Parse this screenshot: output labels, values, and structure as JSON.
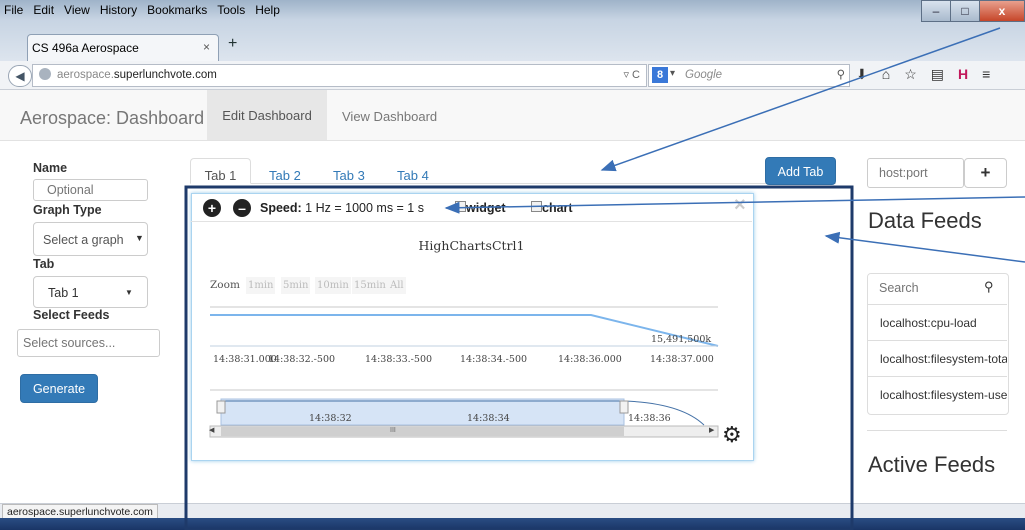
{
  "browser": {
    "menu": [
      "File",
      "Edit",
      "View",
      "History",
      "Bookmarks",
      "Tools",
      "Help"
    ],
    "tab_title": "CS 496a Aerospace",
    "tab_close": "×",
    "new_tab": "+",
    "url_prefix": "aerospace.",
    "url_domain": "superlunchvote.com",
    "search_engine_glyph": "8",
    "search_placeholder": "Google",
    "window_buttons": [
      "–",
      "□",
      "x"
    ],
    "status_url": "aerospace.superlunchvote.com"
  },
  "app": {
    "brand": "Aerospace: Dashboard",
    "nav": [
      "Edit Dashboard",
      "View Dashboard"
    ]
  },
  "form": {
    "name_label": "Name",
    "name_placeholder": "Optional",
    "graph_type_label": "Graph Type",
    "graph_type_value": "Select a graph",
    "tab_label": "Tab",
    "tab_value": "Tab 1",
    "feeds_label": "Select Feeds",
    "feeds_placeholder": "Select sources...",
    "generate": "Generate"
  },
  "tabs": {
    "items": [
      "Tab 1",
      "Tab 2",
      "Tab 3",
      "Tab 4"
    ],
    "add_tab": "Add Tab"
  },
  "widget": {
    "speed_label": "Speed:",
    "speed_value": "1 Hz = 1000 ms = 1 s",
    "widget_checkbox": "widget",
    "chart_checkbox": "chart",
    "close": "×",
    "scroll_mid": "III"
  },
  "chart_data": {
    "type": "line",
    "title": "HighChartsCtrl1",
    "zoom_label": "Zoom",
    "zoom_options": [
      "1min",
      "5min",
      "10min",
      "15min",
      "All"
    ],
    "y_label_top": "15,491,500k",
    "x_ticks": [
      "14:38:31.000",
      "14:38:32.-500",
      "14:38:33.-500",
      "14:38:34.-500",
      "14:38:36.000",
      "14:38:37.000"
    ],
    "navigator_ticks": [
      "14:38:32",
      "14:38:34",
      "14:38:36"
    ],
    "xlabel": "",
    "ylabel": ""
  },
  "right": {
    "host_placeholder": "host:port",
    "add": "+",
    "data_feeds_title": "Data Feeds",
    "search_placeholder": "Search",
    "feeds": [
      "localhost:cpu-load",
      "localhost:filesystem-total",
      "localhost:filesystem-used"
    ],
    "active_feeds_title": "Active Feeds"
  },
  "colors": {
    "primary": "#337ab7",
    "annotation": "#3b6fb6"
  }
}
